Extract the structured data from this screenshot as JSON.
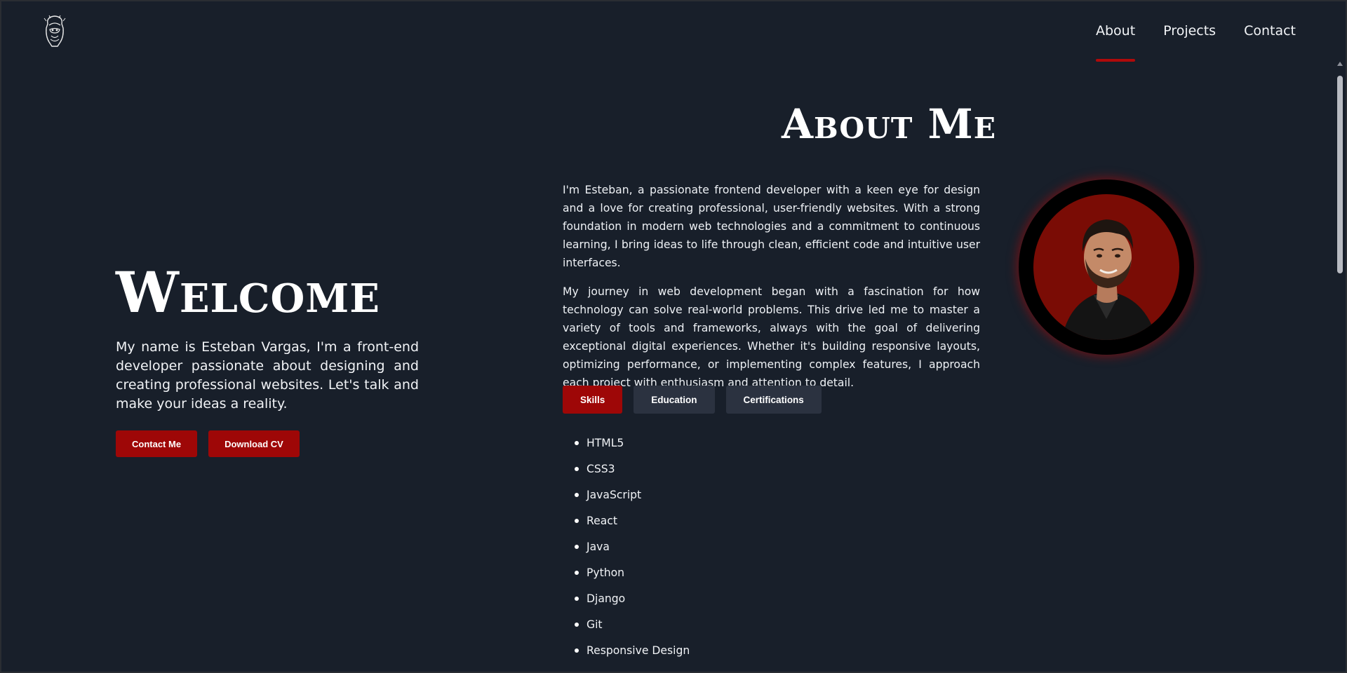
{
  "nav": {
    "logo": "helmet-logo-icon",
    "items": [
      {
        "label": "About",
        "active": true
      },
      {
        "label": "Projects",
        "active": false
      },
      {
        "label": "Contact",
        "active": false
      }
    ]
  },
  "hero": {
    "title": "Welcome",
    "text": "My name is Esteban Vargas, I'm a front-end developer passionate about designing and creating professional websites. Let's talk and make your ideas a reality.",
    "buttons": {
      "contact": "Contact Me",
      "download": "Download CV"
    }
  },
  "about": {
    "title": "About Me",
    "paragraphs": [
      "I'm Esteban, a passionate frontend developer with a keen eye for design and a love for creating professional, user-friendly websites. With a strong foundation in modern web technologies and a commitment to continuous learning, I bring ideas to life through clean, efficient code and intuitive user interfaces.",
      "My journey in web development began with a fascination for how technology can solve real-world problems. This drive led me to master a variety of tools and frameworks, always with the goal of delivering exceptional digital experiences. Whether it's building responsive layouts, optimizing performance, or implementing complex features, I approach each project with enthusiasm and attention to detail."
    ],
    "tabs": [
      {
        "label": "Skills",
        "active": true
      },
      {
        "label": "Education",
        "active": false
      },
      {
        "label": "Certifications",
        "active": false
      }
    ],
    "skills": [
      "HTML5",
      "CSS3",
      "JavaScript",
      "React",
      "Java",
      "Python",
      "Django",
      "Git",
      "Responsive Design"
    ]
  },
  "colors": {
    "background": "#181f2a",
    "accent": "#9e0707",
    "tab_inactive": "#2b3240",
    "text": "#ffffff"
  }
}
